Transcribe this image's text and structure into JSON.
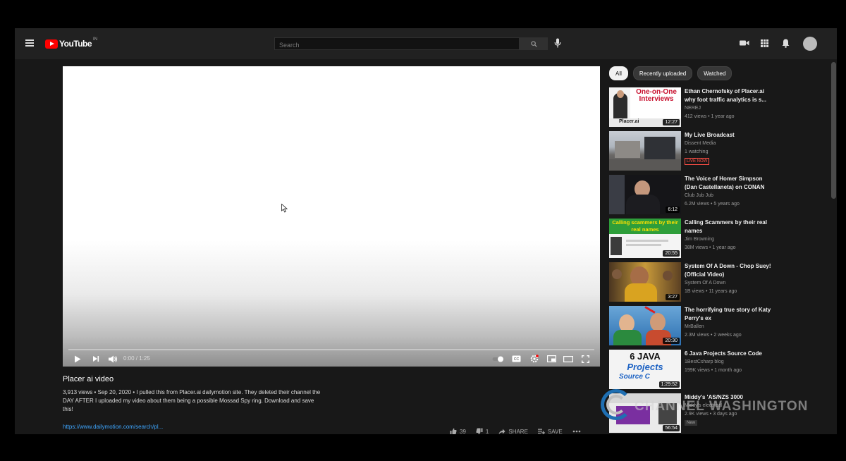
{
  "header": {
    "logo_text": "YouTube",
    "logo_country": "IN",
    "search_placeholder": "Search"
  },
  "player": {
    "time": "0:00 / 1:25",
    "progress": 0
  },
  "video": {
    "title": "Placer ai video",
    "views_date": "3,913 views • Sep 20, 2020",
    "description": " • I pulled this from Placer.ai dailymotion site. They deleted their channel the DAY AFTER I uploaded my video about them being a possible Mossad Spy ring. Download and save this!",
    "link": "https://www.dailymotion.com/search/pl...",
    "likes": "39",
    "dislikes": "1",
    "share_label": "SHARE",
    "save_label": "SAVE"
  },
  "chips": [
    "All",
    "Recently uploaded",
    "Watched"
  ],
  "recommendations": [
    {
      "title": "Ethan Chernofsky of Placer.ai why foot traffic analytics is s...",
      "channel": "NEREJ",
      "stats": "412 views • 1 year ago",
      "duration": "12:27"
    },
    {
      "title": "My Live Broadcast",
      "channel": "Dissent Media",
      "stats": "1 watching",
      "badge": "LIVE NOW"
    },
    {
      "title": "The Voice of Homer Simpson (Dan Castellaneta) on CONAN",
      "channel": "Club Jub Jub",
      "stats": "6.2M views • 5 years ago",
      "duration": "6:12"
    },
    {
      "title": "Calling Scammers by their real names",
      "channel": "Jim Browning",
      "stats": "38M views • 1 year ago",
      "duration": "20:55"
    },
    {
      "title": "System Of A Down - Chop Suey! (Official Video)",
      "channel": "System Of A Down",
      "stats": "1B views • 11 years ago",
      "duration": "3:27"
    },
    {
      "title": "The horrifying true story of Katy Perry's ex",
      "channel": "MrBallen",
      "stats": "2.3M views • 2 weeks ago",
      "duration": "20:30"
    },
    {
      "title": "6 Java Projects Source Code",
      "channel": "1BestCsharp blog",
      "stats": "199K views • 1 month ago",
      "duration": "1:29:52"
    },
    {
      "title": "Middy's 'AS/NZS 3000",
      "channel": "Middy's electrical",
      "stats": "2.9K views • 3 days ago",
      "duration": "56:54",
      "badge_new": "New"
    }
  ],
  "thumb_text": {
    "t1_headline": "One-on-One Interviews",
    "t1_brand": "Placer.ai",
    "t4_headline": "Calling scammers by their real names",
    "t7_line1": "6 JAVA",
    "t7_line2": "Projects",
    "t7_line3": "Source C"
  },
  "watermark_text": "CHANNEL WASHINGTON",
  "colors": {
    "brand_red": "#ff0000",
    "link_blue": "#3ea6ff",
    "app_bg": "#181818"
  }
}
